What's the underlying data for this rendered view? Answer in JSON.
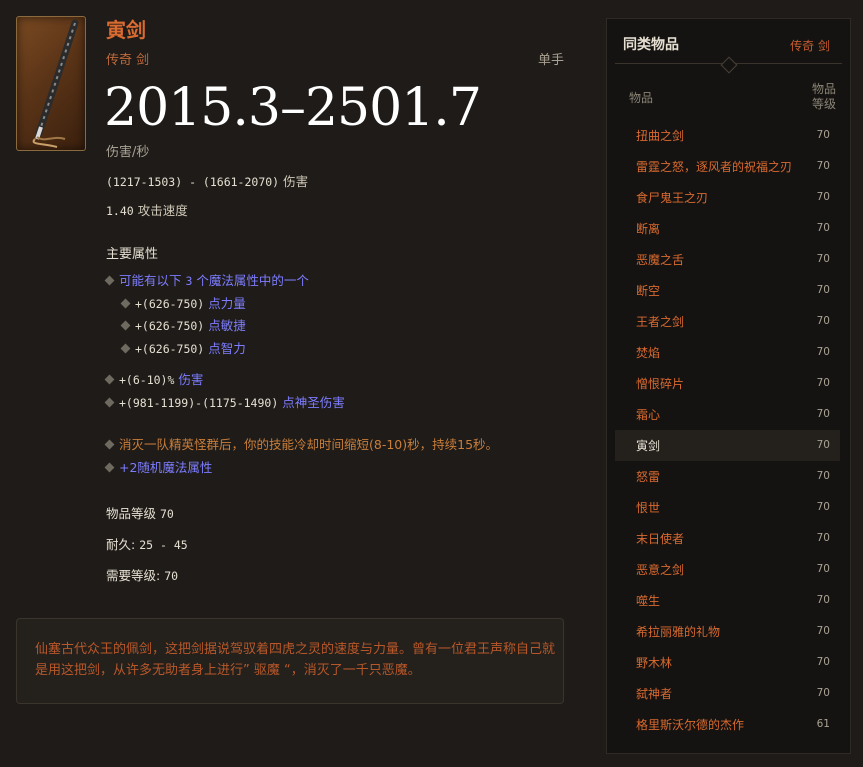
{
  "item": {
    "name": "寅剑",
    "type_line": "传奇 剑",
    "handedness": "单手",
    "dps": "2015.3–2501.7",
    "dps_label": "伤害/秒",
    "damage_range": "(1217-1503) - (1661-2070)",
    "damage_label": "伤害",
    "attack_speed": "1.40",
    "attack_speed_label": "攻击速度",
    "primary_header": "主要属性",
    "random_prefix": "可能有以下",
    "random_count": "3",
    "random_suffix": "个魔法属性中的一个",
    "choices": [
      {
        "range": "+(626-750)",
        "stat": "点力量"
      },
      {
        "range": "+(626-750)",
        "stat": "点敏捷"
      },
      {
        "range": "+(626-750)",
        "stat": "点智力"
      }
    ],
    "damage_pct": {
      "range": "+(6-10)%",
      "stat": "伤害"
    },
    "holy_damage": {
      "range": "+(981-1199)-(1175-1490)",
      "stat": "点神圣伤害"
    },
    "legendary_affix": "消灭一队精英怪群后，你的技能冷却时间缩短(8-10)秒，持续15秒。",
    "random_magic": "+2随机魔法属性",
    "item_level_label": "物品等级",
    "item_level": "70",
    "durability_label": "耐久:",
    "durability": "25 - 45",
    "required_level_label": "需要等级:",
    "required_level": "70",
    "flavor_text": "仙塞古代众王的佩剑，这把剑据说驾驭着四虎之灵的速度与力量。曾有一位君王声称自己就是用这把剑，从许多无助者身上进行” 驱魔 “，消灭了一千只恶魔。"
  },
  "sidebar": {
    "title": "同类物品",
    "type": "传奇 剑",
    "col_item": "物品",
    "col_level_1": "物品",
    "col_level_2": "等级",
    "selected_index": 10,
    "items": [
      {
        "name": "扭曲之剑",
        "level": "70"
      },
      {
        "name": "雷霆之怒，逐风者的祝福之刃",
        "level": "70"
      },
      {
        "name": "食尸鬼王之刃",
        "level": "70"
      },
      {
        "name": "断离",
        "level": "70"
      },
      {
        "name": "恶魔之舌",
        "level": "70"
      },
      {
        "name": "断空",
        "level": "70"
      },
      {
        "name": "王者之剑",
        "level": "70"
      },
      {
        "name": "焚焰",
        "level": "70"
      },
      {
        "name": "憎恨碎片",
        "level": "70"
      },
      {
        "name": "霜心",
        "level": "70"
      },
      {
        "name": "寅剑",
        "level": "70"
      },
      {
        "name": "怒雷",
        "level": "70"
      },
      {
        "name": "恨世",
        "level": "70"
      },
      {
        "name": "末日使者",
        "level": "70"
      },
      {
        "name": "恶意之剑",
        "level": "70"
      },
      {
        "name": "噬生",
        "level": "70"
      },
      {
        "name": "希拉丽雅的礼物",
        "level": "70"
      },
      {
        "name": "野木林",
        "level": "70"
      },
      {
        "name": "弑神者",
        "level": "70"
      },
      {
        "name": "格里斯沃尔德的杰作",
        "level": "61"
      }
    ]
  },
  "colors": {
    "legendary": "#d96a30",
    "magic": "#7d7dff",
    "affix": "#c97e3a",
    "background": "#1e1b18"
  },
  "icons": [
    "sword-icon",
    "bullet-diamond-icon",
    "ornament-diamond-icon"
  ]
}
